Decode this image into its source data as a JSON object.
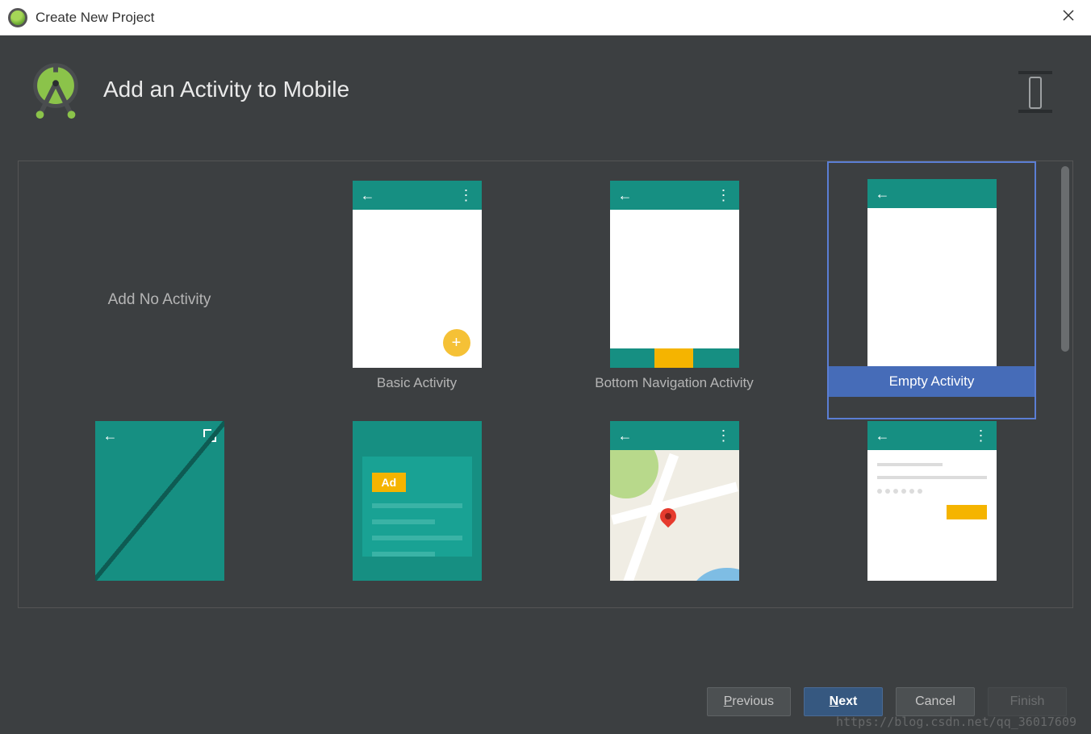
{
  "window": {
    "title": "Create New Project"
  },
  "header": {
    "heading": "Add an Activity to Mobile"
  },
  "activities": [
    {
      "id": "add-no-activity",
      "label": "Add No Activity",
      "selected": false,
      "kind": "none"
    },
    {
      "id": "basic-activity",
      "label": "Basic Activity",
      "selected": false,
      "kind": "basic"
    },
    {
      "id": "bottom-navigation-activity",
      "label": "Bottom Navigation Activity",
      "selected": false,
      "kind": "bottom-nav"
    },
    {
      "id": "empty-activity",
      "label": "Empty Activity",
      "selected": true,
      "kind": "empty"
    },
    {
      "id": "fullscreen-activity",
      "label": "",
      "selected": false,
      "kind": "fullscreen"
    },
    {
      "id": "admob-ads-activity",
      "label": "",
      "selected": false,
      "kind": "admob"
    },
    {
      "id": "google-maps-activity",
      "label": "",
      "selected": false,
      "kind": "maps"
    },
    {
      "id": "login-activity",
      "label": "",
      "selected": false,
      "kind": "login"
    }
  ],
  "ad_text": "Ad",
  "footer": {
    "previous": "Previous",
    "next": "Next",
    "cancel": "Cancel",
    "finish": "Finish"
  },
  "watermark": "https://blog.csdn.net/qq_36017609",
  "colors": {
    "bg": "#3c3f41",
    "teal": "#168f82",
    "accent": "#f5b400",
    "selection": "#466cb8"
  }
}
